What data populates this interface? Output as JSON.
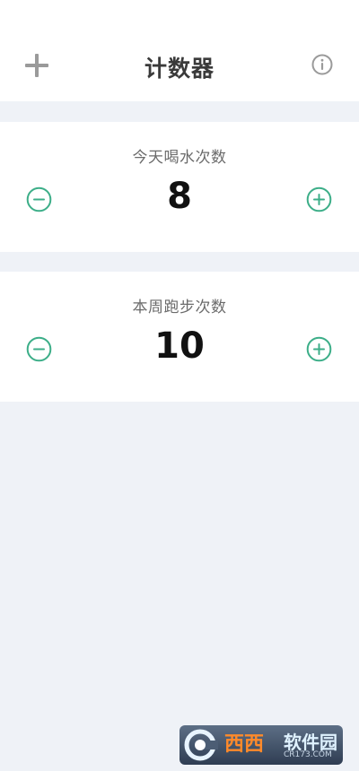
{
  "header": {
    "title": "计数器",
    "add_icon": "plus-icon",
    "info_icon": "info-icon"
  },
  "counters": [
    {
      "label": "今天喝水次数",
      "value": "8",
      "decrement_icon": "minus-circle-icon",
      "increment_icon": "plus-circle-icon"
    },
    {
      "label": "本周跑步次数",
      "value": "10",
      "decrement_icon": "minus-circle-icon",
      "increment_icon": "plus-circle-icon"
    }
  ],
  "colors": {
    "accent": "#3cae88",
    "background": "#eff2f7",
    "card": "#ffffff",
    "icon_gray": "#9a9a9a"
  },
  "watermark": {
    "brand": "西西",
    "brand_suffix": "软件园",
    "domain": "CR173.COM"
  }
}
